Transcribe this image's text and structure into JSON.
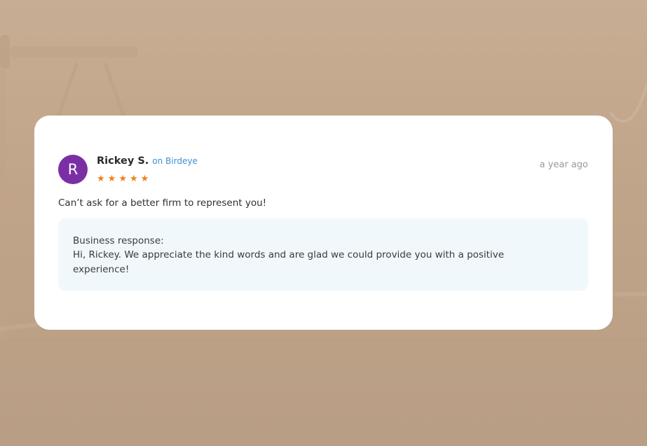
{
  "review": {
    "avatar_initial": "R",
    "reviewer_name": "Rickey S.",
    "platform": "on Birdeye",
    "rating": 5,
    "stars": [
      "★",
      "★",
      "★",
      "★",
      "★"
    ],
    "timestamp": "a year ago",
    "text": "Can’t ask for a better firm to represent you!",
    "response": {
      "label": "Business response:",
      "body": "Hi, Rickey. We appreciate the kind words and are glad we could provide you with a positive experience!"
    }
  },
  "icons": {
    "star": "star-icon",
    "background": "scales-of-justice-icon"
  },
  "colors": {
    "avatar": "#7b2fa5",
    "platform_link": "#3f8fd2",
    "star": "#f07f1a",
    "response_bg": "#f1f8fc",
    "backdrop": "#c0a489",
    "card": "#ffffff"
  }
}
